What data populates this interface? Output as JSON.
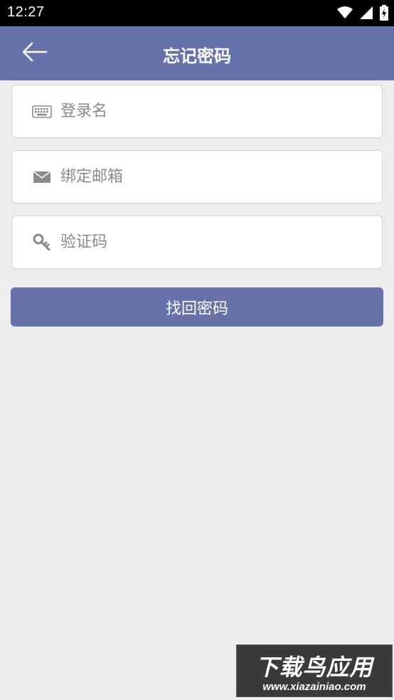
{
  "status_bar": {
    "time": "12:27",
    "icons": [
      "wifi-icon",
      "signal-icon",
      "battery-icon"
    ]
  },
  "app_bar": {
    "title": "忘记密码",
    "back_icon": "arrow-left-icon"
  },
  "form": {
    "login_name": {
      "placeholder": "登录名",
      "value": "",
      "icon": "keyboard-icon"
    },
    "bound_email": {
      "placeholder": "绑定邮箱",
      "value": "",
      "icon": "mail-icon"
    },
    "verification_code": {
      "placeholder": "验证码",
      "value": "",
      "icon": "key-icon"
    },
    "submit_label": "找回密码"
  },
  "watermark": {
    "title": "下载鸟应用",
    "url": "www.xiazainiao.com"
  },
  "colors": {
    "accent": "#6772aa",
    "background": "#ededed",
    "icon_gray": "#8a8a8a"
  }
}
